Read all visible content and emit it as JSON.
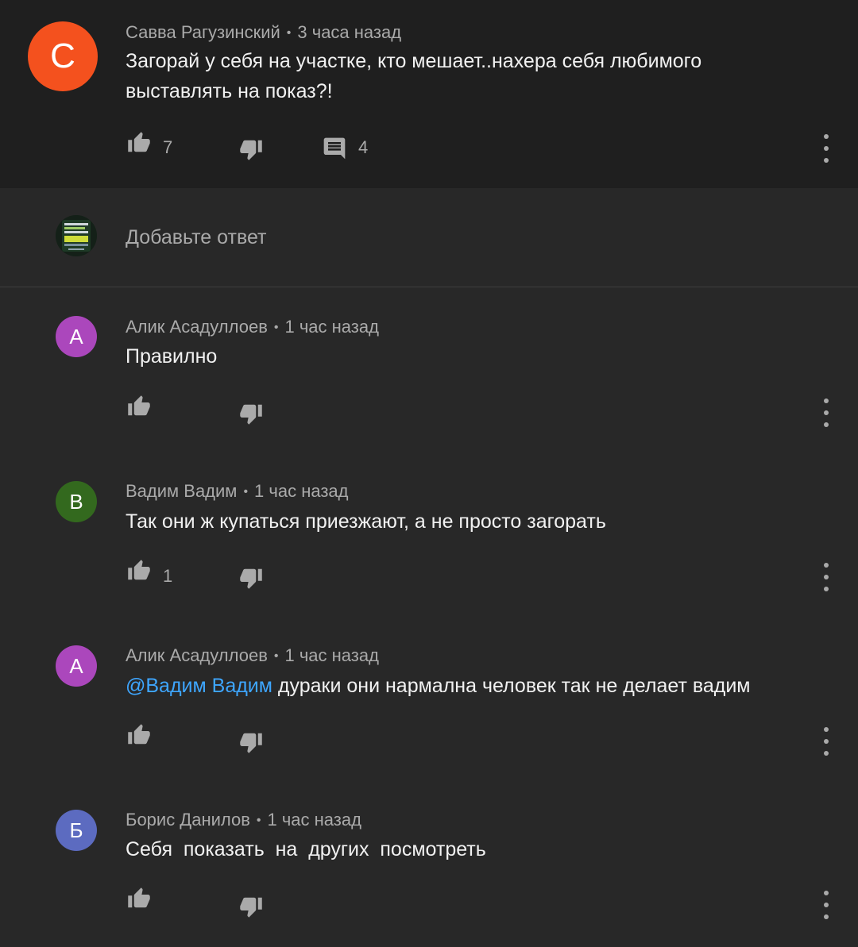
{
  "parent_comment": {
    "avatar_letter": "С",
    "avatar_color": "#f4511e",
    "author": "Савва Рагузинский",
    "time": "3 часа назад",
    "text_line1": "Загорай у себя на участке, кто мешает..нахера себя любимого",
    "text_line2": "выставлять на показ?!",
    "likes": "7",
    "replies": "4"
  },
  "reply_input": {
    "placeholder": "Добавьте ответ"
  },
  "replies": [
    {
      "avatar_letter": "А",
      "avatar_color": "#ab47bc",
      "author": "Алик Асадуллоев",
      "time": "1 час назад",
      "text": "Правилно",
      "likes": ""
    },
    {
      "avatar_letter": "В",
      "avatar_color": "#33691e",
      "author": "Вадим Вадим",
      "time": "1 час назад",
      "text": "Так они ж купаться приезжают, а не просто загорать",
      "likes": "1"
    },
    {
      "avatar_letter": "А",
      "avatar_color": "#ab47bc",
      "author": "Алик Асадуллоев",
      "time": "1 час назад",
      "mention": "@Вадим Вадим",
      "text": "дураки они нармална человек так не делает вадим",
      "likes": ""
    },
    {
      "avatar_letter": "Б",
      "avatar_color": "#5c6bc0",
      "author": "Борис Данилов",
      "time": "1 час назад",
      "text": "Себя  показать  на  других  посмотреть",
      "likes": ""
    }
  ],
  "colors": {
    "background": "#282828",
    "parent_background": "#1f1f1f",
    "primary_text": "#f1f1f1",
    "secondary_text": "#aaaaaa",
    "mention": "#3ea6ff"
  }
}
